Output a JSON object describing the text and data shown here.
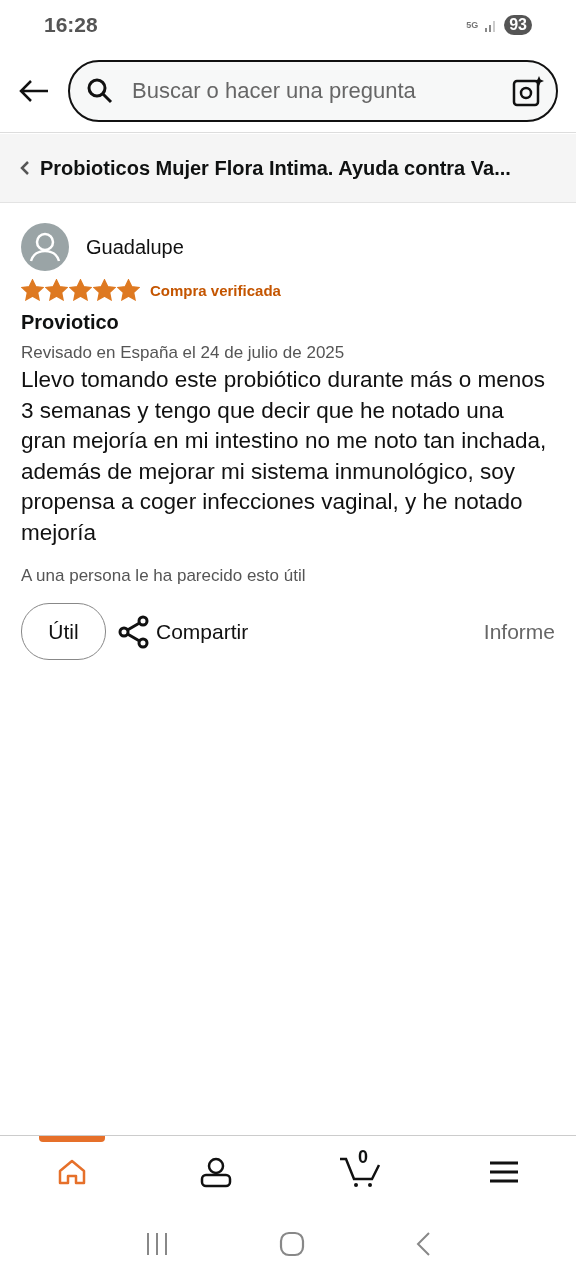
{
  "status_bar": {
    "time": "16:28",
    "network": "5G",
    "battery": "93"
  },
  "search": {
    "placeholder": "Buscar o hacer una pregunta"
  },
  "breadcrumb": {
    "title": "Probioticos Mujer Flora Intima. Ayuda contra Va..."
  },
  "review": {
    "reviewer": "Guadalupe",
    "stars": 5,
    "badge": "Compra verificada",
    "title": "Proviotico",
    "date": "Revisado en España el 24 de julio de 2025",
    "body": "Llevo tomando este probiótico durante más o menos 3 semanas y tengo que decir que he notado una gran mejoría en mi intestino no me noto tan inchada, además de mejorar mi sistema inmunológico, soy propensa a coger infecciones vaginal, y he notado mejoría",
    "helpful_count": "A una persona le ha parecido esto útil",
    "helpful_button": "Útil",
    "share_button": "Compartir",
    "report_link": "Informe"
  },
  "bottom_nav": [
    {
      "kind": "home",
      "selected": true
    },
    {
      "kind": "account",
      "selected": false
    },
    {
      "kind": "cart",
      "selected": false,
      "count": "0"
    },
    {
      "kind": "menu",
      "selected": false
    }
  ]
}
